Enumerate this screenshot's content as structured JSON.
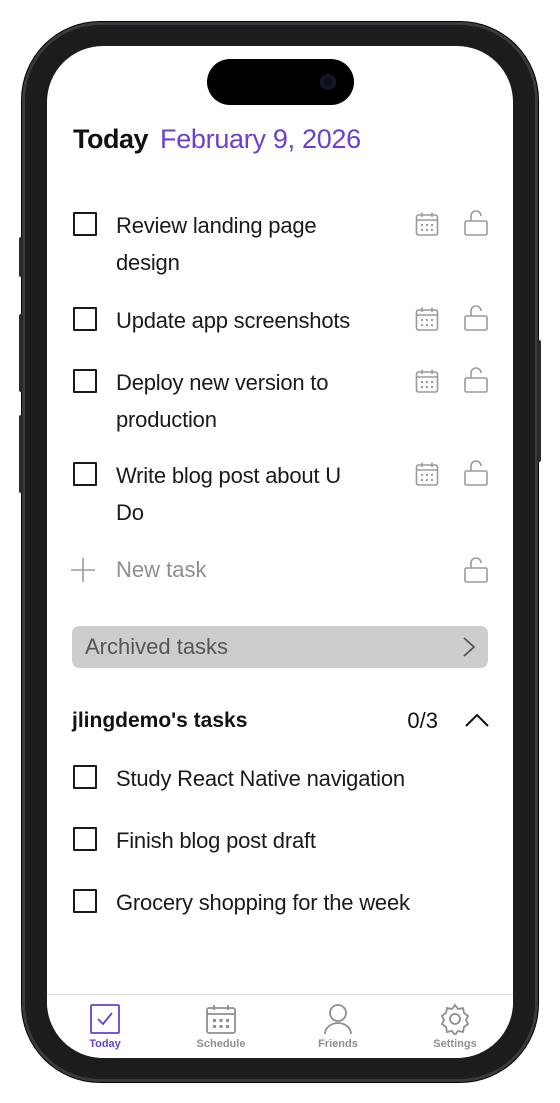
{
  "header": {
    "title": "Today",
    "date": "February 9, 2026"
  },
  "tasks": [
    {
      "label": "Review landing page design"
    },
    {
      "label": "Update app screenshots"
    },
    {
      "label": "Deploy new version to production"
    },
    {
      "label": "Write blog post about U Do"
    }
  ],
  "new_task": {
    "label": "New task"
  },
  "archived": {
    "label": "Archived tasks"
  },
  "friend_group": {
    "title": "jlingdemo's tasks",
    "count": "0/3",
    "tasks": [
      {
        "label": "Study React Native navigation"
      },
      {
        "label": "Finish blog post draft"
      },
      {
        "label": "Grocery shopping for the week"
      }
    ]
  },
  "tabs": [
    {
      "label": "Today",
      "icon": "checkbox-icon",
      "active": true
    },
    {
      "label": "Schedule",
      "icon": "calendar-icon",
      "active": false
    },
    {
      "label": "Friends",
      "icon": "person-icon",
      "active": false
    },
    {
      "label": "Settings",
      "icon": "gear-icon",
      "active": false
    }
  ],
  "colors": {
    "accent": "#6a3fd4",
    "muted": "#8e8e93",
    "archived_bg": "#cdcdcd"
  }
}
